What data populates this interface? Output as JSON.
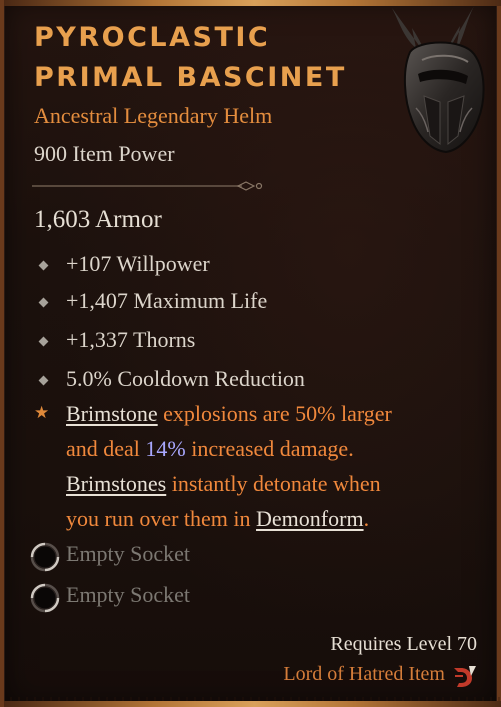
{
  "item": {
    "name_line1": "PYROCLASTIC",
    "name_line2": "PRIMAL BASCINET",
    "type": "Ancestral Legendary Helm",
    "item_power": "900 Item Power",
    "armor": "1,603 Armor",
    "affixes": [
      "+107 Willpower",
      "+1,407 Maximum Life",
      "+1,337 Thorns",
      "5.0% Cooldown Reduction"
    ],
    "legendary_aspect": {
      "line1": {
        "kw": "Brimstone",
        "rest": " explosions are 50% larger"
      },
      "line2": {
        "pre": "and deal ",
        "num": "14%",
        "post": " increased damage."
      },
      "line3": {
        "kw": "Brimstones",
        "rest": " instantly detonate when"
      },
      "line4": {
        "pre": "you run over them in ",
        "kw": "Demonform",
        "post": "."
      }
    },
    "sockets": [
      "Empty Socket",
      "Empty Socket"
    ],
    "requirement": "Requires Level 70",
    "expansion": "Lord of Hatred Item"
  },
  "colors": {
    "title": "#e8a04e",
    "legendary_text": "#f0883c",
    "highlight_number": "#a9a8ff",
    "socket_text": "#7c7872"
  },
  "icons": {
    "helm": "helm-art",
    "affix_bullet": "diamond-bullet-icon",
    "legendary_bullet": "star-icon",
    "socket": "empty-socket-icon",
    "expansion": "expansion-logo-icon"
  }
}
